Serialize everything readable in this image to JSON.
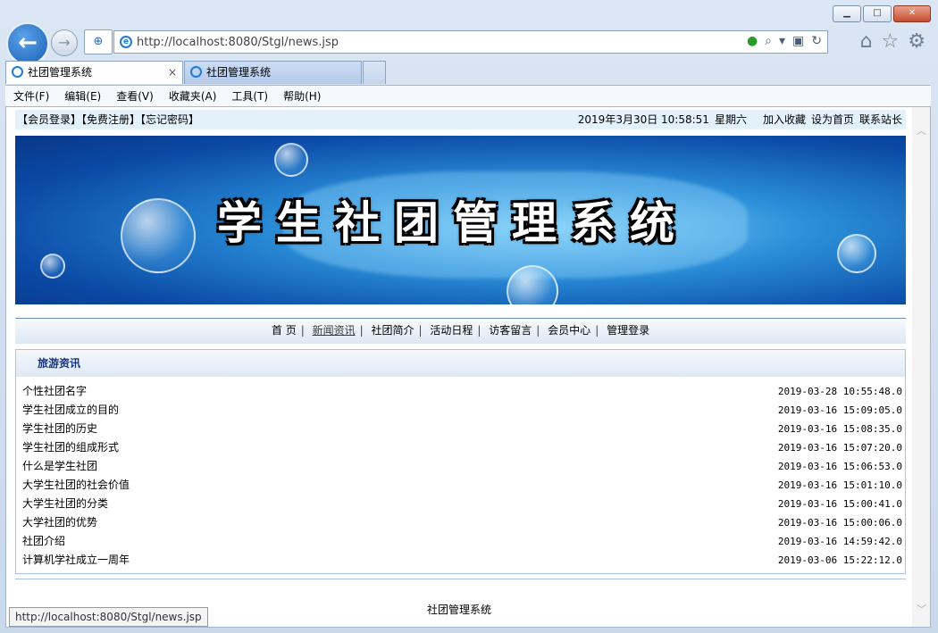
{
  "browser": {
    "url": "http://localhost:8080/Stgl/news.jsp",
    "tabs": [
      {
        "label": "社团管理系统"
      },
      {
        "label": "社团管理系统"
      }
    ],
    "menu": [
      "文件(F)",
      "编辑(E)",
      "查看(V)",
      "收藏夹(A)",
      "工具(T)",
      "帮助(H)"
    ],
    "status_url": "http://localhost:8080/Stgl/news.jsp"
  },
  "topbar": {
    "left": "【会员登录】【免费注册】【忘记密码】",
    "datetime": "2019年3月30日 10:58:51",
    "weekday": "星期六",
    "links": [
      "加入收藏",
      "设为首页",
      "联系站长"
    ]
  },
  "banner": {
    "title": "学生社团管理系统"
  },
  "nav": [
    "首 页",
    "新闻资讯",
    "社团简介",
    "活动日程",
    "访客留言",
    "会员中心",
    "管理登录"
  ],
  "news": {
    "heading": "旅游资讯",
    "items": [
      {
        "title": "个性社团名字",
        "date": "2019-03-28 10:55:48.0"
      },
      {
        "title": "学生社团成立的目的",
        "date": "2019-03-16 15:09:05.0"
      },
      {
        "title": "学生社团的历史",
        "date": "2019-03-16 15:08:35.0"
      },
      {
        "title": "学生社团的组成形式",
        "date": "2019-03-16 15:07:20.0"
      },
      {
        "title": "什么是学生社团",
        "date": "2019-03-16 15:06:53.0"
      },
      {
        "title": "大学生社团的社会价值",
        "date": "2019-03-16 15:01:10.0"
      },
      {
        "title": "大学生社团的分类",
        "date": "2019-03-16 15:00:41.0"
      },
      {
        "title": "大学社团的优势",
        "date": "2019-03-16 15:00:06.0"
      },
      {
        "title": "社团介绍",
        "date": "2019-03-16 14:59:42.0"
      },
      {
        "title": "计算机学社成立一周年",
        "date": "2019-03-06 15:22:12.0"
      }
    ]
  },
  "footer": "社团管理系统"
}
